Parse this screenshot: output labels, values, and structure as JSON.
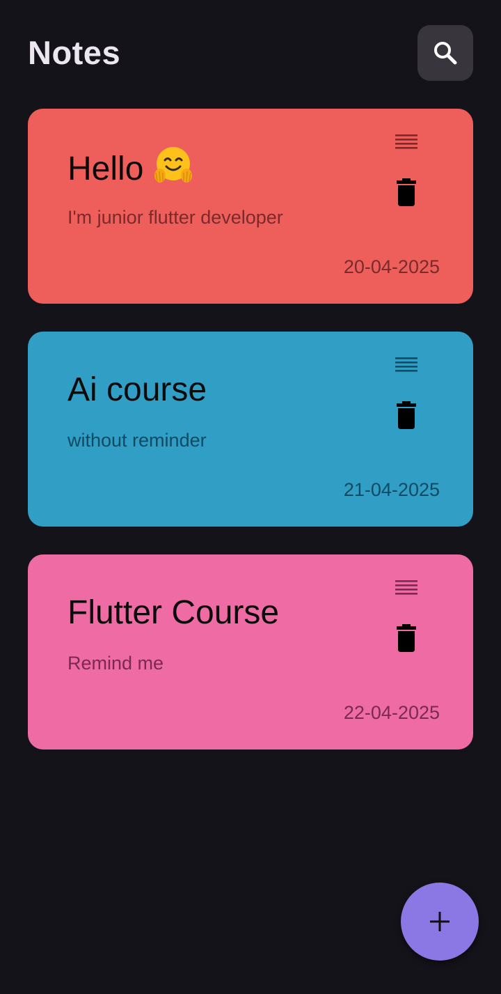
{
  "header": {
    "title": "Notes",
    "search_icon": "search-icon"
  },
  "notes": [
    {
      "title": "Hello",
      "emoji": "🤗",
      "body": "I'm junior flutter developer",
      "date": "20-04-2025",
      "color": "#ee5f5b",
      "text_color": "#7a2a2a"
    },
    {
      "title": "Ai course",
      "body": "without reminder",
      "date": "21-04-2025",
      "color": "#319ec6",
      "text_color": "#0f4b62"
    },
    {
      "title": "Flutter Course",
      "body": "Remind me",
      "date": "22-04-2025",
      "color": "#ef6ba3",
      "text_color": "#7a2a4e"
    }
  ],
  "icons": {
    "reorder": "reorder-icon",
    "delete": "delete-icon",
    "add": "add-icon"
  },
  "fab": {
    "color": "#8c78e4"
  },
  "background": "#15131a"
}
